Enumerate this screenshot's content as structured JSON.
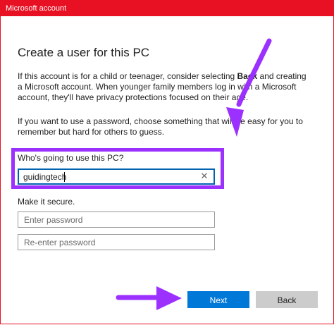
{
  "window": {
    "title": "Microsoft account"
  },
  "page": {
    "heading": "Create a user for this PC",
    "para1_a": "If this account is for a child or teenager, consider selecting ",
    "para1_bold": "Back",
    "para1_b": " and creating a Microsoft account. When younger family members log in with a Microsoft account, they'll have privacy protections focused on their age.",
    "para2": "If you want to use a password, choose something that will be easy for you to remember but hard for others to guess."
  },
  "form": {
    "user_label": "Who's going to use this PC?",
    "user_value": "guidingtech",
    "secure_label": "Make it secure.",
    "password_placeholder": "Enter password",
    "reenter_placeholder": "Re-enter password"
  },
  "buttons": {
    "next": "Next",
    "back": "Back"
  },
  "icons": {
    "clear": "close-icon"
  },
  "colors": {
    "titlebar": "#e81123",
    "annotation": "#9b30ff",
    "primary_button": "#0078d7",
    "secondary_button": "#cccccc"
  }
}
